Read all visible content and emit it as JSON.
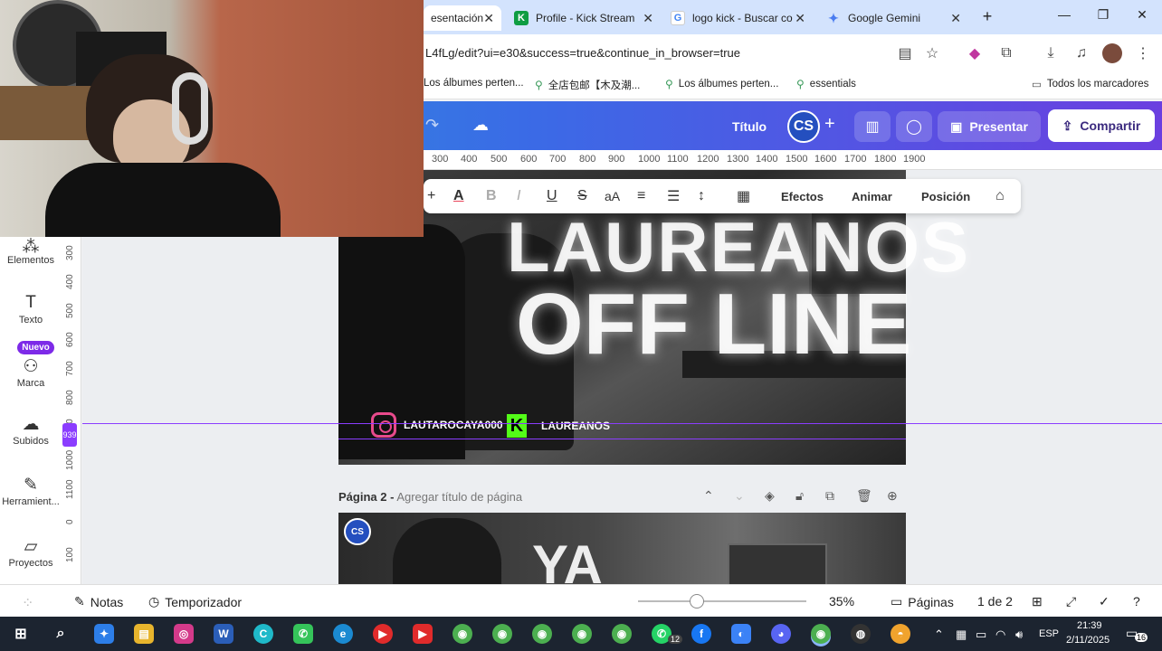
{
  "browser": {
    "tabs": [
      {
        "label": "esentación",
        "active": true
      },
      {
        "label": "Profile - Kick Stream",
        "active": false
      },
      {
        "label": "logo kick - Buscar co",
        "active": false
      },
      {
        "label": "Google Gemini",
        "active": false
      }
    ],
    "url": "L4fLg/edit?ui=e30&success=true&continue_in_browser=true",
    "bookmarks": [
      "Los álbumes perten...",
      "全店包邮【木及潮...",
      "Los álbumes perten...",
      "essentials"
    ],
    "all_bookmarks": "Todos los marcadores"
  },
  "canva": {
    "title": "Título",
    "avatar": "CS",
    "presentar": "Presentar",
    "compartir": "Compartir",
    "ruler_ticks": [
      "300",
      "400",
      "500",
      "600",
      "700",
      "800",
      "900",
      "1000",
      "1100",
      "1200",
      "1300",
      "1400",
      "1500",
      "1600",
      "1700",
      "1800",
      "1900"
    ],
    "vruler_ticks": [
      "300",
      "400",
      "500",
      "600",
      "700",
      "800",
      "900",
      "1000",
      "1100",
      "0",
      "100"
    ],
    "vruler_marker": "939",
    "toolbar": {
      "efectos": "Efectos",
      "animar": "Animar",
      "posicion": "Posición"
    },
    "sidebar": {
      "items": [
        {
          "label": "Elementos"
        },
        {
          "label": "Texto"
        },
        {
          "label": "Marca"
        },
        {
          "label": "Subidos"
        },
        {
          "label": "Herramient..."
        },
        {
          "label": "Proyectos"
        }
      ],
      "badge": "Nuevo"
    },
    "page1": {
      "headline1": "LAUREANOS",
      "headline2": "OFF LINE",
      "instagram": "LAUTAROCAYA000",
      "kick": "LAUREANOS"
    },
    "page2": {
      "label": "Página 2 -",
      "sublabel": "Agregar título de página",
      "text": "YA",
      "avatar": "CS"
    },
    "bottom": {
      "notas": "Notas",
      "temporizador": "Temporizador",
      "zoom": "35%",
      "zoom_level": 0.35,
      "paginas": "Páginas",
      "page_count": "1 de 2"
    }
  },
  "taskbar": {
    "lang": "ESP",
    "time": "21:39",
    "date": "2/11/2025",
    "notifications": "16",
    "whatsapp_badge": "12"
  }
}
